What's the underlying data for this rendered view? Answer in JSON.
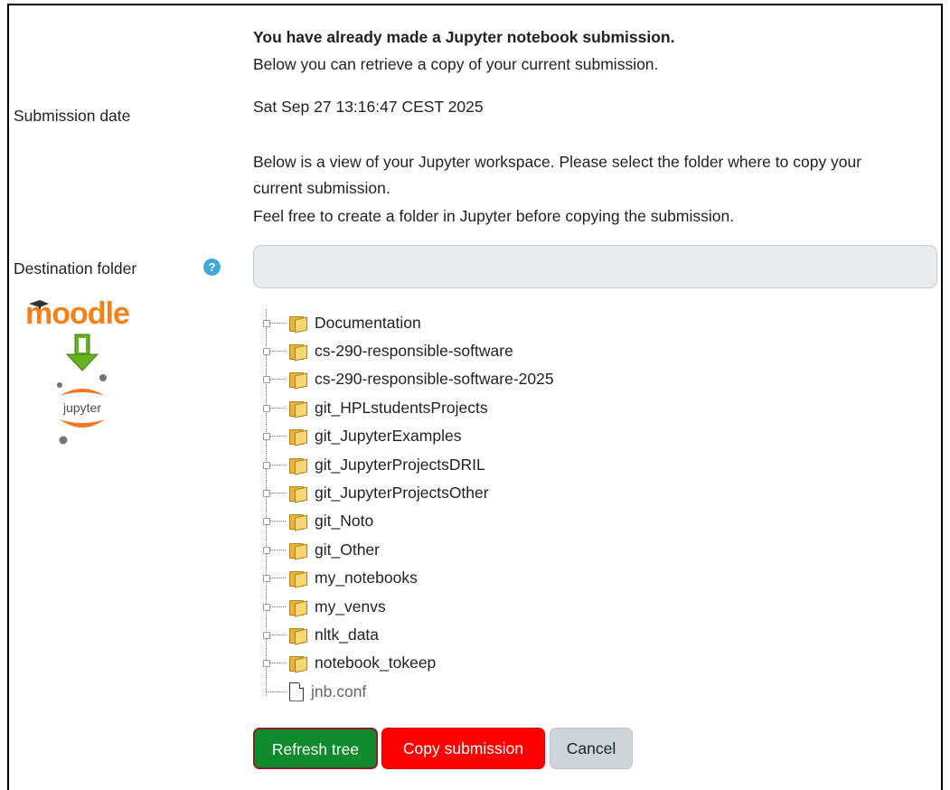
{
  "header": {
    "title": "You have already made a Jupyter notebook submission.",
    "subtitle": "Below you can retrieve a copy of your current submission."
  },
  "submission": {
    "label": "Submission date",
    "value": "Sat Sep 27 13:16:47 CEST 2025"
  },
  "instructions": {
    "line1": "Below is a view of your Jupyter workspace. Please select the folder where to copy your",
    "line2": "current submission.",
    "line3": "Feel free to create a folder in Jupyter before copying the submission."
  },
  "destination": {
    "label": "Destination folder",
    "help_icon": "?",
    "value": "",
    "placeholder": ""
  },
  "logo": {
    "moodle_text": "moodle",
    "jupyter_text": "jupyter",
    "moodle_color": "#f98012",
    "arrow_color": "#6ab023",
    "jupyter_color": "#f37726"
  },
  "tree": {
    "items": [
      {
        "label": "Documentation",
        "type": "folder"
      },
      {
        "label": "cs-290-responsible-software",
        "type": "folder"
      },
      {
        "label": "cs-290-responsible-software-2025",
        "type": "folder"
      },
      {
        "label": "git_HPLstudentsProjects",
        "type": "folder"
      },
      {
        "label": "git_JupyterExamples",
        "type": "folder"
      },
      {
        "label": "git_JupyterProjectsDRIL",
        "type": "folder"
      },
      {
        "label": "git_JupyterProjectsOther",
        "type": "folder"
      },
      {
        "label": "git_Noto",
        "type": "folder"
      },
      {
        "label": "git_Other",
        "type": "folder"
      },
      {
        "label": "my_notebooks",
        "type": "folder"
      },
      {
        "label": "my_venvs",
        "type": "folder"
      },
      {
        "label": "nltk_data",
        "type": "folder"
      },
      {
        "label": "notebook_tokeep",
        "type": "folder"
      },
      {
        "label": "jnb.conf",
        "type": "file"
      }
    ]
  },
  "buttons": {
    "refresh": "Refresh tree",
    "copy": "Copy submission",
    "cancel": "Cancel"
  },
  "colors": {
    "refresh_bg": "#0f8a2c",
    "copy_bg": "#ff0000",
    "cancel_bg": "#ced4da",
    "help_icon": "#3fa9d8"
  }
}
